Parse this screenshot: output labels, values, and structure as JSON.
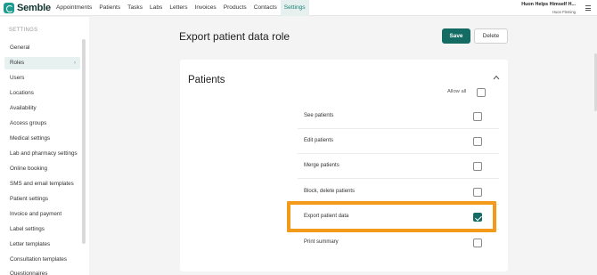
{
  "app": {
    "logo_text": "Semble",
    "nav": [
      "Appointments",
      "Patients",
      "Tasks",
      "Labs",
      "Letters",
      "Invoices",
      "Products",
      "Contacts",
      "Settings"
    ],
    "active_nav": "Settings",
    "account_name": "Huon Helps Himself H...",
    "account_sub": "Huon Fleming"
  },
  "sidebar": {
    "heading": "SETTINGS",
    "items": [
      {
        "label": "General"
      },
      {
        "label": "Roles",
        "active": true
      },
      {
        "label": "Users"
      },
      {
        "label": "Locations"
      },
      {
        "label": "Availability"
      },
      {
        "label": "Access groups"
      },
      {
        "label": "Medical settings"
      },
      {
        "label": "Lab and pharmacy settings"
      },
      {
        "label": "Online booking"
      },
      {
        "label": "SMS and email templates"
      },
      {
        "label": "Patient settings"
      },
      {
        "label": "Invoice and payment"
      },
      {
        "label": "Label settings"
      },
      {
        "label": "Letter templates"
      },
      {
        "label": "Consultation templates"
      },
      {
        "label": "Questionnaires"
      }
    ]
  },
  "main": {
    "title": "Export patient data role",
    "save_label": "Save",
    "delete_label": "Delete",
    "section_title": "Patients",
    "allow_all_label": "Allow all",
    "allow_all_checked": false,
    "permissions": [
      {
        "label": "See patients",
        "checked": false
      },
      {
        "label": "Edit patients",
        "checked": false
      },
      {
        "label": "Merge patients",
        "checked": false
      },
      {
        "label": "Block, delete patients",
        "checked": false
      },
      {
        "label": "Export patient data",
        "checked": true,
        "highlighted": true
      },
      {
        "label": "Print summary",
        "checked": false
      }
    ]
  },
  "colors": {
    "brand": "#146b63",
    "highlight": "#f39a1a"
  }
}
